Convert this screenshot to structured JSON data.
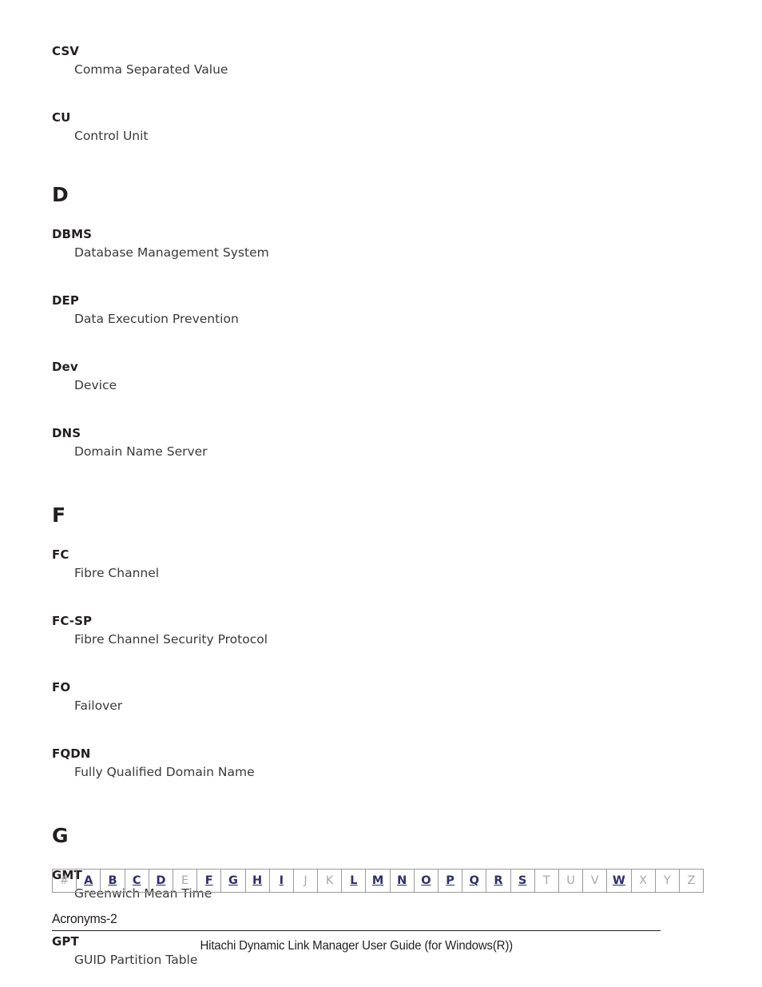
{
  "document": {
    "entries_before_d": [
      {
        "term": "CSV",
        "definition": "Comma Separated Value"
      },
      {
        "term": "CU",
        "definition": "Control Unit"
      }
    ],
    "sections": [
      {
        "letter": "D",
        "entries": [
          {
            "term": "DBMS",
            "definition": "Database Management System"
          },
          {
            "term": "DEP",
            "definition": "Data Execution Prevention"
          },
          {
            "term": "Dev",
            "definition": "Device"
          },
          {
            "term": "DNS",
            "definition": "Domain Name Server"
          }
        ]
      },
      {
        "letter": "F",
        "entries": [
          {
            "term": "FC",
            "definition": "Fibre Channel"
          },
          {
            "term": "FC-SP",
            "definition": "Fibre Channel Security Protocol"
          },
          {
            "term": "FO",
            "definition": "Failover"
          },
          {
            "term": "FQDN",
            "definition": "Fully Qualified Domain Name"
          }
        ]
      },
      {
        "letter": "G",
        "entries": [
          {
            "term": "GMT",
            "definition": "Greenwich Mean Time"
          },
          {
            "term": "GPT",
            "definition": "GUID Partition Table"
          }
        ]
      }
    ]
  },
  "alphabet_nav": {
    "items": [
      {
        "label": "#",
        "active": false
      },
      {
        "label": "A",
        "active": true
      },
      {
        "label": "B",
        "active": true
      },
      {
        "label": "C",
        "active": true
      },
      {
        "label": "D",
        "active": true
      },
      {
        "label": "E",
        "active": false
      },
      {
        "label": "F",
        "active": true
      },
      {
        "label": "G",
        "active": true
      },
      {
        "label": "H",
        "active": true
      },
      {
        "label": "I",
        "active": true
      },
      {
        "label": "J",
        "active": false
      },
      {
        "label": "K",
        "active": false
      },
      {
        "label": "L",
        "active": true
      },
      {
        "label": "M",
        "active": true
      },
      {
        "label": "N",
        "active": true
      },
      {
        "label": "O",
        "active": true
      },
      {
        "label": "P",
        "active": true
      },
      {
        "label": "Q",
        "active": true
      },
      {
        "label": "R",
        "active": true
      },
      {
        "label": "S",
        "active": true
      },
      {
        "label": "T",
        "active": false
      },
      {
        "label": "U",
        "active": false
      },
      {
        "label": "V",
        "active": false
      },
      {
        "label": "W",
        "active": true
      },
      {
        "label": "X",
        "active": false
      },
      {
        "label": "Y",
        "active": false
      },
      {
        "label": "Z",
        "active": false
      }
    ],
    "link_color": "#2e2e6e",
    "disabled_color": "#a8a8a8"
  },
  "footer": {
    "page_label": "Acronyms-2",
    "title": "Hitachi Dynamic Link Manager User Guide (for Windows(R))"
  }
}
